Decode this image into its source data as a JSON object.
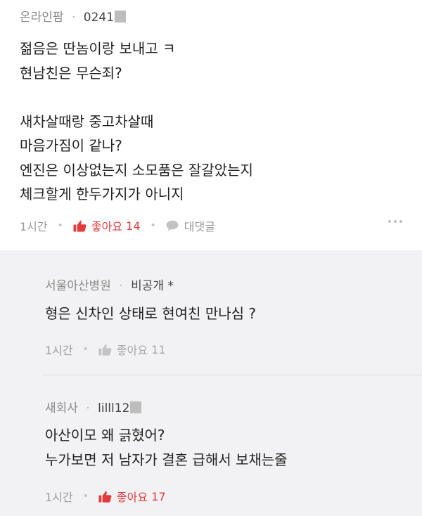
{
  "post": {
    "board": "온라인팜",
    "separator": "·",
    "nickname": "0241",
    "body_lines": [
      "젊음은 딴놈이랑 보내고 ㅋ",
      "현남친은 무슨죄?",
      "",
      "새차살때랑 중고차살때",
      "마음가짐이 같나?",
      "엔진은 이상없는지 소모품은 잘갈았는지",
      "체크할게 한두가지가 아니지"
    ],
    "time": "1시간",
    "like_label": "좋아요",
    "like_count": "14",
    "reply_label": "대댓글"
  },
  "comments": [
    {
      "board": "서울아산병원",
      "separator": "·",
      "nickname": "비공개 *",
      "lines": [
        "형은 신차인 상태로 현여친 만나심 ?"
      ],
      "time": "1시간",
      "like_label": "좋아요",
      "like_count": "11"
    },
    {
      "board": "새회사",
      "separator": "·",
      "nickname": "lilll12",
      "lines": [
        "아산이모 왜 긁혔어?",
        "누가보면 저 남자가 결혼 급해서 보채는줄"
      ],
      "time": "1시간",
      "like_label": "좋아요",
      "like_count": "17"
    }
  ],
  "colors": {
    "like_active": "#e63a3a",
    "like_inactive": "#a7a7a7",
    "comment_bg": "#f2f2f4"
  },
  "icons": {
    "like": "thumbs-up-icon",
    "reply": "speech-bubble-icon",
    "more": "more-dots-icon"
  }
}
